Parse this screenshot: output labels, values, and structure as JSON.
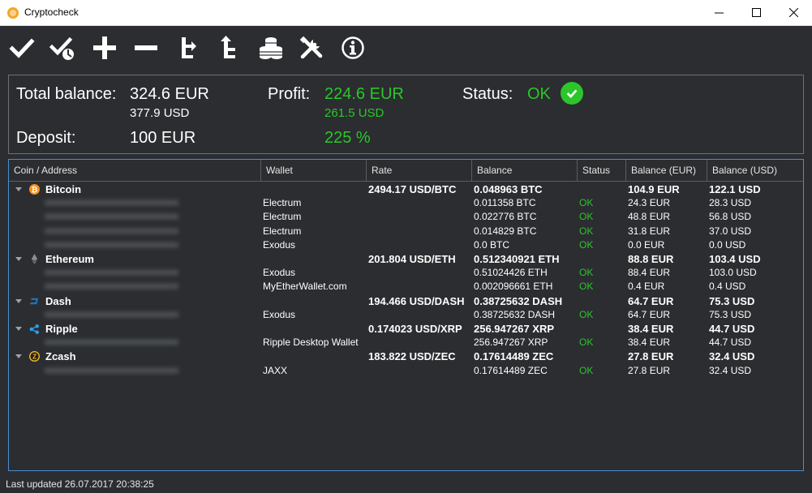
{
  "window": {
    "title": "Cryptocheck",
    "icon": "cryptocheck-app-icon"
  },
  "toolbar": {
    "buttons": [
      {
        "name": "check-icon"
      },
      {
        "name": "check-all-icon"
      },
      {
        "name": "add-icon"
      },
      {
        "name": "remove-icon"
      },
      {
        "name": "collapse-tree-icon"
      },
      {
        "name": "expand-tree-icon"
      },
      {
        "name": "coins-icon"
      },
      {
        "name": "settings-tools-icon"
      },
      {
        "name": "info-icon"
      }
    ]
  },
  "summary": {
    "total_balance_label": "Total balance:",
    "total_balance_eur": "324.6 EUR",
    "total_balance_usd": "377.9 USD",
    "deposit_label": "Deposit:",
    "deposit_value": "100 EUR",
    "profit_label": "Profit:",
    "profit_eur": "224.6 EUR",
    "profit_usd": "261.5 USD",
    "profit_percent": "225 %",
    "status_label": "Status:",
    "status_value": "OK"
  },
  "table": {
    "columns": [
      "Coin / Address",
      "Wallet",
      "Rate",
      "Balance",
      "Status",
      "Balance (EUR)",
      "Balance (USD)"
    ],
    "coins": [
      {
        "name": "Bitcoin",
        "icon": "bitcoin-icon",
        "rate": "2494.17 USD/BTC",
        "balance": "0.048963 BTC",
        "status": "",
        "balance_eur": "104.9 EUR",
        "balance_usd": "122.1 USD",
        "addresses": [
          {
            "wallet": "Electrum",
            "balance": "0.011358 BTC",
            "status": "OK",
            "balance_eur": "24.3 EUR",
            "balance_usd": "28.3 USD"
          },
          {
            "wallet": "Electrum",
            "balance": "0.022776 BTC",
            "status": "OK",
            "balance_eur": "48.8 EUR",
            "balance_usd": "56.8 USD"
          },
          {
            "wallet": "Electrum",
            "balance": "0.014829 BTC",
            "status": "OK",
            "balance_eur": "31.8 EUR",
            "balance_usd": "37.0 USD"
          },
          {
            "wallet": "Exodus",
            "balance": "0.0 BTC",
            "status": "OK",
            "balance_eur": "0.0 EUR",
            "balance_usd": "0.0 USD"
          }
        ]
      },
      {
        "name": "Ethereum",
        "icon": "ethereum-icon",
        "rate": "201.804 USD/ETH",
        "balance": "0.51234092​1 ETH",
        "status": "",
        "balance_eur": "88.8 EUR",
        "balance_usd": "103.4 USD",
        "addresses": [
          {
            "wallet": "Exodus",
            "balance": "0.51024426 ETH",
            "status": "OK",
            "balance_eur": "88.4 EUR",
            "balance_usd": "103.0 USD"
          },
          {
            "wallet": "MyEtherWallet.com",
            "balance": "0.002096661 ETH",
            "status": "OK",
            "balance_eur": "0.4 EUR",
            "balance_usd": "0.4 USD"
          }
        ]
      },
      {
        "name": "Dash",
        "icon": "dash-icon",
        "rate": "194.466 USD/DASH",
        "balance": "0.38725632 DASH",
        "status": "",
        "balance_eur": "64.7 EUR",
        "balance_usd": "75.3 USD",
        "addresses": [
          {
            "wallet": "Exodus",
            "balance": "0.38725632 DASH",
            "status": "OK",
            "balance_eur": "64.7 EUR",
            "balance_usd": "75.3 USD"
          }
        ]
      },
      {
        "name": "Ripple",
        "icon": "ripple-icon",
        "rate": "0.174023 USD/XRP",
        "balance": "256.947267 XRP",
        "status": "",
        "balance_eur": "38.4 EUR",
        "balance_usd": "44.7 USD",
        "addresses": [
          {
            "wallet": "Ripple Desktop Wallet",
            "balance": "256.947267 XRP",
            "status": "OK",
            "balance_eur": "38.4 EUR",
            "balance_usd": "44.7 USD"
          }
        ]
      },
      {
        "name": "Zcash",
        "icon": "zcash-icon",
        "rate": "183.822 USD/ZEC",
        "balance": "0.17614489 ZEC",
        "status": "",
        "balance_eur": "27.8 EUR",
        "balance_usd": "32.4 USD",
        "addresses": [
          {
            "wallet": "JAXX",
            "balance": "0.17614489 ZEC",
            "status": "OK",
            "balance_eur": "27.8 EUR",
            "balance_usd": "32.4 USD"
          }
        ]
      }
    ]
  },
  "statusbar": {
    "text": "Last updated 26.07.2017 20:38:25"
  },
  "colors": {
    "background": "#2b2d30",
    "ok_green": "#28c828",
    "table_border": "#4a8ecf",
    "bitcoin": "#f7931a",
    "dash": "#1c75bc",
    "ripple": "#2aa0e6",
    "zcash": "#f4b728"
  }
}
